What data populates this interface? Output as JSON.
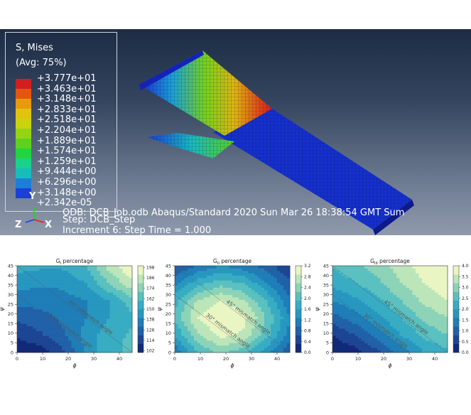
{
  "fe_view": {
    "legend_title_1": "S, Mises",
    "legend_title_2": "(Avg: 75%)",
    "legend_values": [
      "+3.777e+01",
      "+3.463e+01",
      "+3.148e+01",
      "+2.833e+01",
      "+2.518e+01",
      "+2.204e+01",
      "+1.889e+01",
      "+1.574e+01",
      "+1.259e+01",
      "+9.444e+00",
      "+6.296e+00",
      "+3.148e+00",
      "+2.342e-05"
    ],
    "legend_colors": [
      "#d11f1f",
      "#e3560f",
      "#e99a0c",
      "#e0c40f",
      "#c9d40f",
      "#96d216",
      "#5cd21f",
      "#22d43e",
      "#18d28c",
      "#19bcbc",
      "#1c7fd6",
      "#1b3fd8",
      "#1414d0"
    ],
    "info_line_1": "ODB: DCB_Job.odb    Abaqus/Standard 2020    Sun Mar 26 18:38:54 GMT Sum",
    "info_line_2": "Step: DCB_Step",
    "info_line_3": "Increment      6: Step Time =    1.000",
    "triad_y": "Y",
    "triad_z": "Z",
    "triad_x": "X"
  },
  "chart_data": [
    {
      "type": "heatmap",
      "title": "G_I percentage",
      "title_main": "G",
      "title_sub": "I",
      "title_rest": " percentage",
      "xlabel": "ϕ",
      "ylabel": "ψ",
      "x_ticks": [
        0,
        10,
        20,
        30,
        40
      ],
      "y_ticks": [
        0,
        5,
        10,
        15,
        20,
        25,
        30,
        35,
        40,
        45
      ],
      "xlim": [
        0,
        45
      ],
      "ylim": [
        0,
        45
      ],
      "colorbar_ticks": [
        102,
        114,
        126,
        138,
        150,
        162,
        174,
        186,
        198
      ],
      "colorbar_range": [
        100,
        200
      ],
      "annotations": [
        "45° mismatch angle",
        "30° mismatch angle"
      ],
      "grid_x": [
        0,
        9,
        18,
        27,
        36,
        45
      ],
      "grid_y": [
        0,
        9,
        18,
        27,
        36,
        45
      ],
      "z": [
        [
          100,
          104,
          118,
          142,
          158,
          162
        ],
        [
          112,
          118,
          128,
          144,
          156,
          162
        ],
        [
          122,
          126,
          132,
          140,
          150,
          158
        ],
        [
          134,
          134,
          136,
          140,
          150,
          166
        ],
        [
          144,
          142,
          142,
          150,
          170,
          188
        ],
        [
          154,
          152,
          152,
          160,
          184,
          200
        ]
      ]
    },
    {
      "type": "heatmap",
      "title": "G_II percentage",
      "title_main": "G",
      "title_sub": "II",
      "title_rest": " percentage",
      "xlabel": "ϕ",
      "ylabel": "ψ",
      "x_ticks": [
        0,
        10,
        20,
        30,
        40
      ],
      "y_ticks": [
        0,
        5,
        10,
        15,
        20,
        25,
        30,
        35,
        40,
        45
      ],
      "xlim": [
        0,
        45
      ],
      "ylim": [
        0,
        45
      ],
      "colorbar_ticks": [
        0.0,
        0.4,
        0.8,
        1.2,
        1.6,
        2.0,
        2.4,
        2.8,
        3.2
      ],
      "colorbar_range": [
        0,
        3.2
      ],
      "annotations": [
        "45° mismatch angle",
        "30° mismatch angle"
      ],
      "grid_x": [
        0,
        9,
        18,
        27,
        36,
        45
      ],
      "grid_y": [
        0,
        9,
        18,
        27,
        36,
        45
      ],
      "z": [
        [
          1.0,
          1.9,
          2.3,
          2.0,
          1.4,
          0.7
        ],
        [
          1.6,
          2.5,
          3.0,
          2.8,
          2.0,
          1.1
        ],
        [
          2.0,
          2.9,
          3.2,
          3.0,
          2.2,
          1.3
        ],
        [
          1.8,
          2.6,
          2.9,
          2.6,
          1.9,
          1.0
        ],
        [
          1.2,
          1.8,
          2.1,
          1.9,
          1.3,
          0.7
        ],
        [
          0.6,
          1.0,
          1.3,
          1.1,
          0.8,
          0.3
        ]
      ]
    },
    {
      "type": "heatmap",
      "title": "G_III percentage",
      "title_main": "G",
      "title_sub": "III",
      "title_rest": " percentage",
      "xlabel": "ϕ",
      "ylabel": "ψ",
      "x_ticks": [
        0,
        10,
        20,
        30,
        40
      ],
      "y_ticks": [
        0,
        5,
        10,
        15,
        20,
        25,
        30,
        35,
        40,
        45
      ],
      "xlim": [
        0,
        45
      ],
      "ylim": [
        0,
        45
      ],
      "colorbar_ticks": [
        0.0,
        0.5,
        1.0,
        1.5,
        2.0,
        2.5,
        3.0,
        3.5,
        4.0
      ],
      "colorbar_range": [
        0,
        4.0
      ],
      "annotations": [
        "45° mismatch angle",
        "30° mismatch angle"
      ],
      "grid_x": [
        0,
        9,
        18,
        27,
        36,
        45
      ],
      "grid_y": [
        0,
        9,
        18,
        27,
        36,
        45
      ],
      "z": [
        [
          0.0,
          0.2,
          0.7,
          1.4,
          2.0,
          2.3
        ],
        [
          0.4,
          0.8,
          1.4,
          2.0,
          2.5,
          2.8
        ],
        [
          1.0,
          1.4,
          1.9,
          2.4,
          2.9,
          3.2
        ],
        [
          1.6,
          1.9,
          2.3,
          2.8,
          3.3,
          3.6
        ],
        [
          2.1,
          2.4,
          2.7,
          3.2,
          3.6,
          3.9
        ],
        [
          2.4,
          2.7,
          3.0,
          3.4,
          3.8,
          4.0
        ]
      ]
    }
  ]
}
